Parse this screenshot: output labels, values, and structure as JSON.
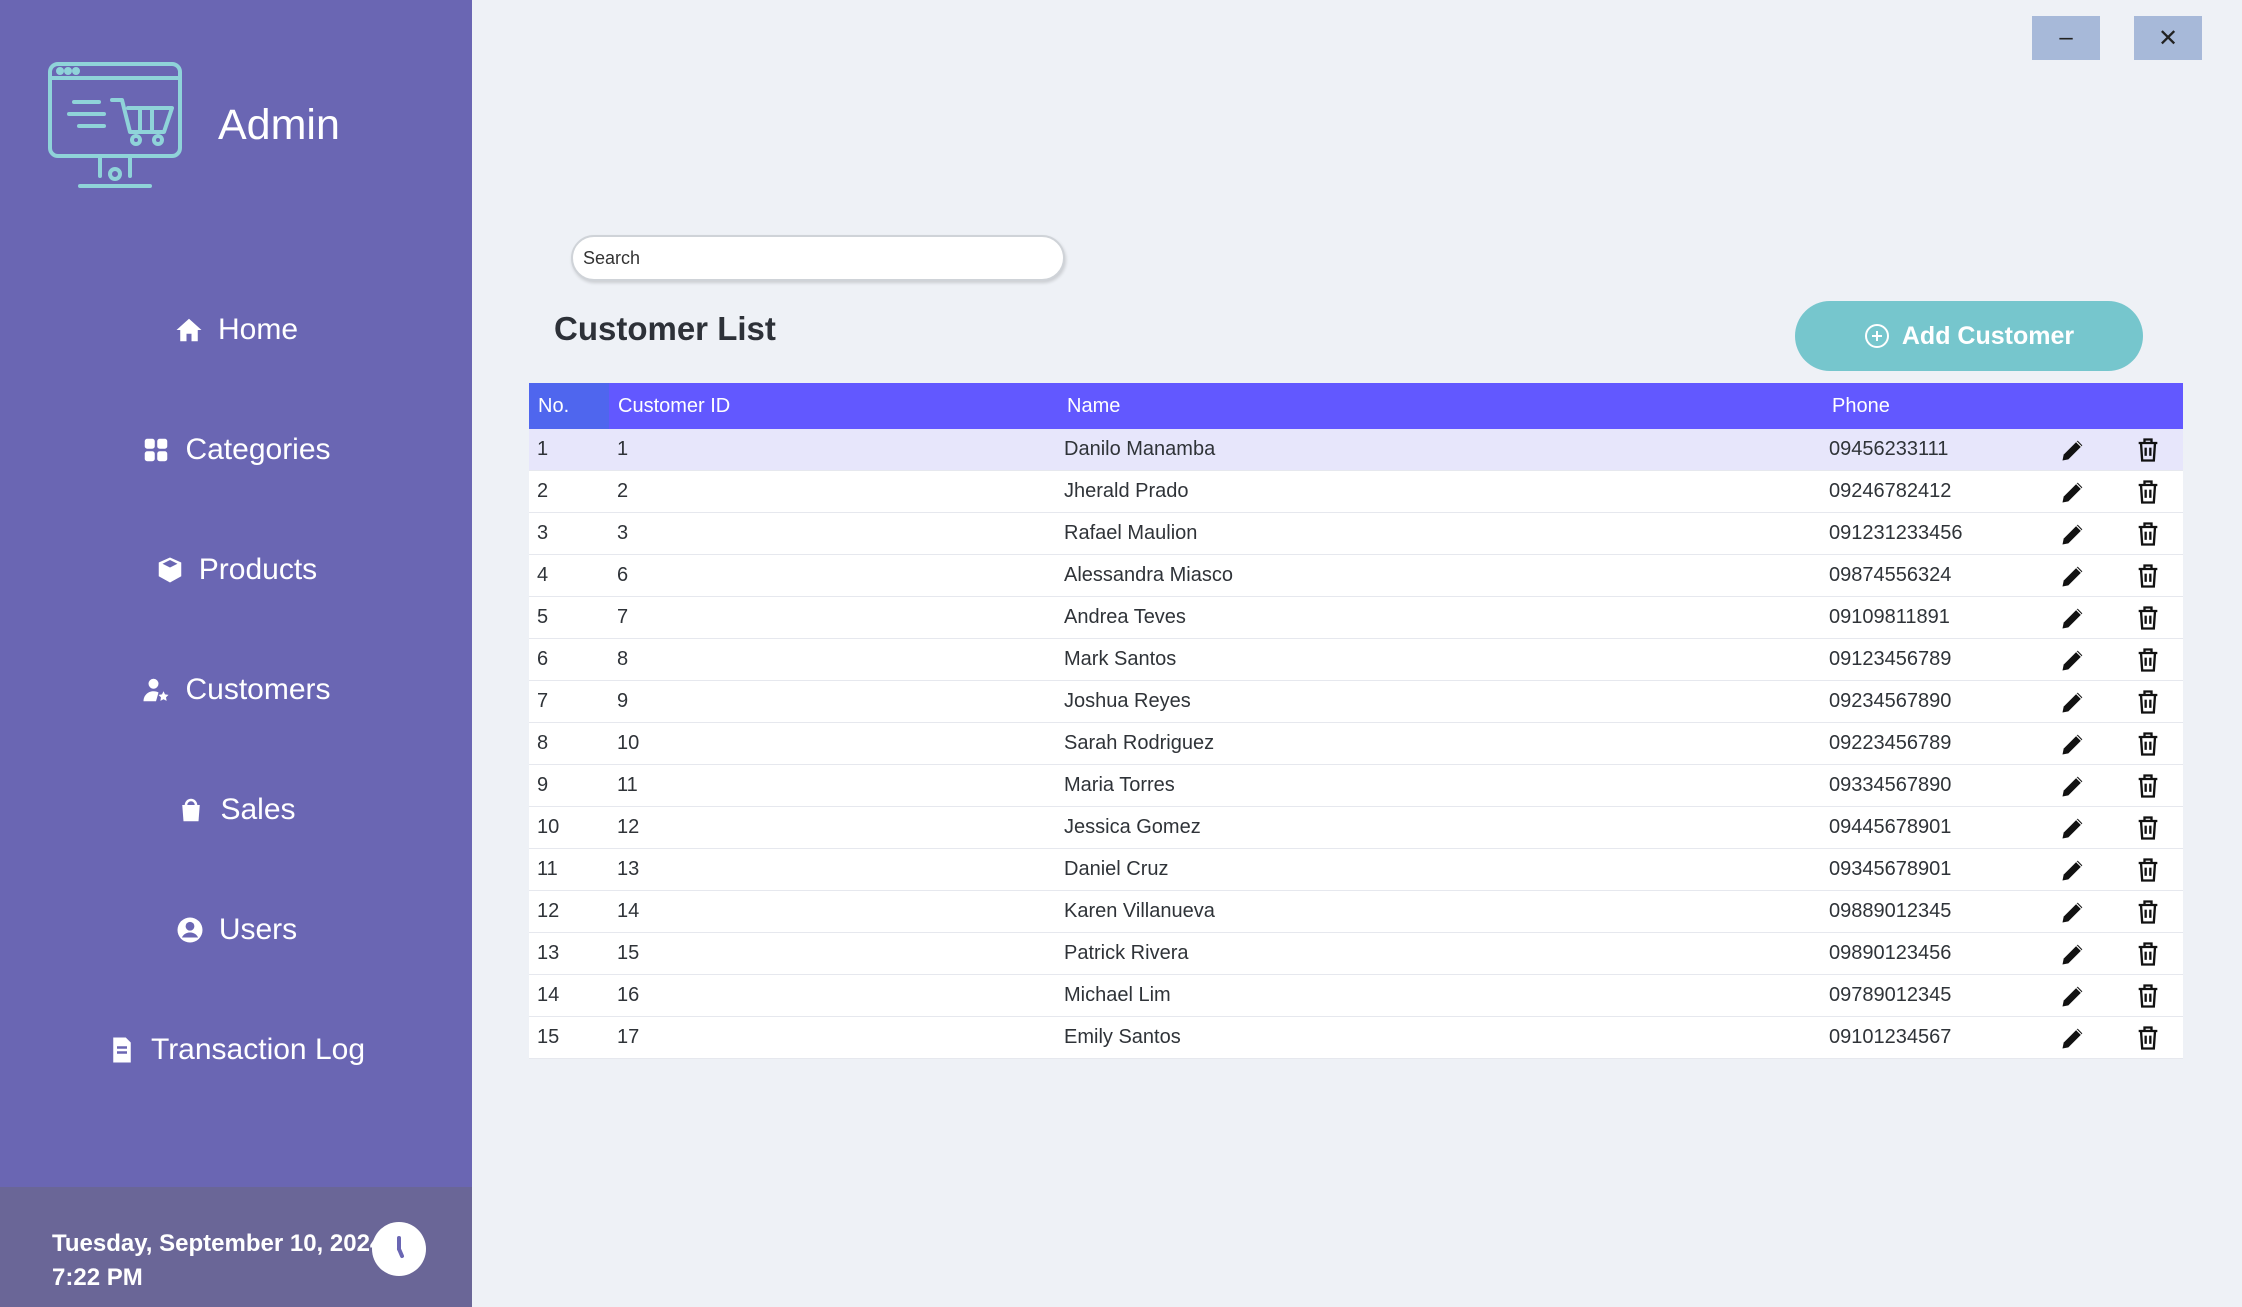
{
  "sidebar": {
    "title": "Admin",
    "logo_icon": "monitor-cart-icon",
    "items": [
      {
        "label": "Home",
        "icon": "home-icon"
      },
      {
        "label": "Categories",
        "icon": "categories-icon"
      },
      {
        "label": "Products",
        "icon": "products-icon"
      },
      {
        "label": "Customers",
        "icon": "customers-icon"
      },
      {
        "label": "Sales",
        "icon": "sales-bag-icon"
      },
      {
        "label": "Users",
        "icon": "users-icon"
      },
      {
        "label": "Transaction Log",
        "icon": "document-icon"
      }
    ],
    "date": "Tuesday, September 10, 2024",
    "time": "7:22 PM"
  },
  "window": {
    "minimize": "–",
    "close": "✕"
  },
  "search": {
    "placeholder": "Search"
  },
  "page": {
    "title": "Customer List",
    "add_button": "Add Customer"
  },
  "table": {
    "headers": {
      "no": "No.",
      "id": "Customer ID",
      "name": "Name",
      "phone": "Phone"
    },
    "rows": [
      {
        "no": "1",
        "id": "1",
        "name": "Danilo Manamba",
        "phone": "09456233111"
      },
      {
        "no": "2",
        "id": "2",
        "name": "Jherald Prado",
        "phone": "09246782412"
      },
      {
        "no": "3",
        "id": "3",
        "name": "Rafael Maulion",
        "phone": "091231233456"
      },
      {
        "no": "4",
        "id": "6",
        "name": "Alessandra Miasco",
        "phone": "09874556324"
      },
      {
        "no": "5",
        "id": "7",
        "name": "Andrea Teves",
        "phone": "09109811891"
      },
      {
        "no": "6",
        "id": "8",
        "name": "Mark Santos",
        "phone": "09123456789"
      },
      {
        "no": "7",
        "id": "9",
        "name": "Joshua Reyes",
        "phone": "09234567890"
      },
      {
        "no": "8",
        "id": "10",
        "name": "Sarah Rodriguez",
        "phone": "09223456789"
      },
      {
        "no": "9",
        "id": "11",
        "name": "Maria Torres",
        "phone": "09334567890"
      },
      {
        "no": "10",
        "id": "12",
        "name": "Jessica Gomez",
        "phone": "09445678901"
      },
      {
        "no": "11",
        "id": "13",
        "name": "Daniel Cruz",
        "phone": "09345678901"
      },
      {
        "no": "12",
        "id": "14",
        "name": "Karen Villanueva",
        "phone": "09889012345"
      },
      {
        "no": "13",
        "id": "15",
        "name": "Patrick Rivera",
        "phone": "09890123456"
      },
      {
        "no": "14",
        "id": "16",
        "name": "Michael Lim",
        "phone": "09789012345"
      },
      {
        "no": "15",
        "id": "17",
        "name": "Emily Santos",
        "phone": "09101234567"
      }
    ]
  },
  "colors": {
    "sidebar": "#6a66b3",
    "table_header": "#6258ff",
    "accent_button": "#76c6cd",
    "selected_row": "#e7e6fb"
  }
}
